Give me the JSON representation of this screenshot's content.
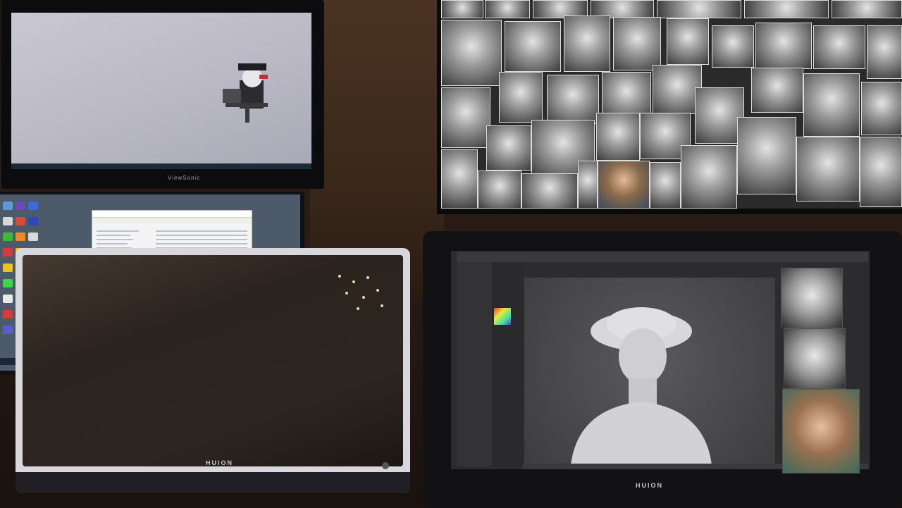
{
  "scene": {
    "monitors": [
      {
        "brand": "ViewSonic",
        "content": "desktop-with-character"
      },
      {
        "brand": "",
        "content": "windows-desktop-and-file-explorer"
      },
      {
        "brand": "HUION",
        "content": "off-screen"
      },
      {
        "brand": "",
        "content": "portrait-collage"
      },
      {
        "brand": "HUION",
        "content": "zbrush-sculpting"
      }
    ]
  },
  "labels": {
    "viewsonic": "ViewSonic",
    "huion_left": "HUION",
    "huion_right": "HUION"
  },
  "colors": {
    "wall": "#4a3322",
    "viewsonic_screen": "#c9c8d2",
    "zbrush_canvas": "#4a4a4e",
    "sculpt": "#d4d4d6"
  },
  "icons": {
    "character": "pirate-character-icon",
    "palette": "color-palette-icon"
  }
}
